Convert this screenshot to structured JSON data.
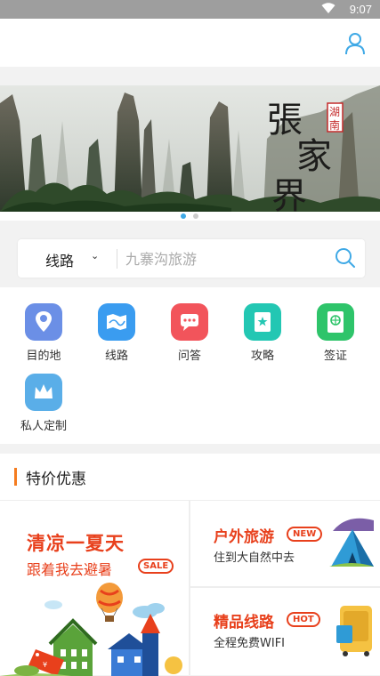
{
  "status_bar": {
    "time": "9:07"
  },
  "banner": {
    "calligraphy": "張家界",
    "seal": "湖南"
  },
  "search": {
    "category": "线路",
    "placeholder": "九寨沟旅游"
  },
  "nav": [
    {
      "label": "目的地",
      "color": "#6b8fe6"
    },
    {
      "label": "线路",
      "color": "#3a9cf0"
    },
    {
      "label": "问答",
      "color": "#f2545b"
    },
    {
      "label": "攻略",
      "color": "#23c7b3"
    },
    {
      "label": "签证",
      "color": "#2ec46a"
    },
    {
      "label": "私人定制",
      "color": "#5aaee8"
    }
  ],
  "section": {
    "title": "特价优惠"
  },
  "promos": {
    "main": {
      "title": "清凉一夏天",
      "subtitle": "跟着我去避暑",
      "badge": "SALE"
    },
    "items": [
      {
        "title": "户外旅游",
        "badge": "NEW",
        "subtitle": "住到大自然中去"
      },
      {
        "title": "精品线路",
        "badge": "HOT",
        "subtitle": "全程免费WIFI"
      }
    ]
  },
  "colors": {
    "accent": "#f57c1f",
    "promo_red": "#e8401c",
    "icon_blue": "#3fa9e6"
  }
}
